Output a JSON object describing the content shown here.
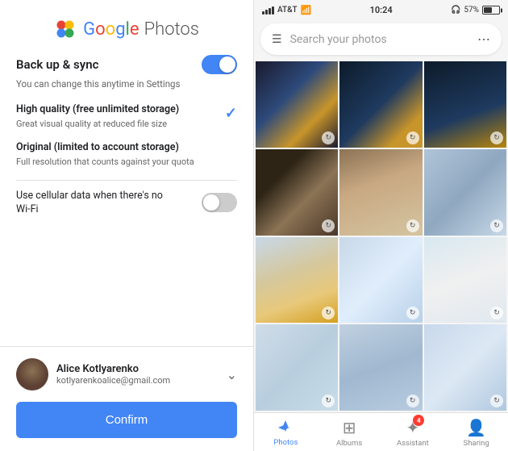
{
  "left": {
    "logo": {
      "google": "Google",
      "photos": "Photos"
    },
    "backup": {
      "title": "Back up & sync",
      "subtitle": "You can change this anytime\nin Settings",
      "toggle_on": true
    },
    "high_quality": {
      "title": "High quality (free unlimited storage)",
      "desc": "Great visual quality at reduced\nfile size",
      "selected": true
    },
    "original": {
      "title": "Original (limited to account storage)",
      "desc": "Full resolution that counts against\nyour quota",
      "selected": false
    },
    "cellular": {
      "text": "Use cellular data when there's\nno Wi-Fi",
      "toggle_on": false
    },
    "account": {
      "name": "Alice Kotlyarenko",
      "email": "kotlyarenkoalice@gmail.com"
    },
    "confirm_label": "Confirm"
  },
  "right": {
    "status_bar": {
      "carrier": "AT&T",
      "time": "10:24",
      "battery": "57%"
    },
    "search_placeholder": "Search your photos",
    "tabs": [
      {
        "label": "Photos",
        "icon": "🏔",
        "active": true
      },
      {
        "label": "Albums",
        "icon": "📋",
        "active": false
      },
      {
        "label": "Assistant",
        "icon": "➕",
        "active": false,
        "badge": "4"
      },
      {
        "label": "Sharing",
        "icon": "👤",
        "active": false
      }
    ]
  }
}
